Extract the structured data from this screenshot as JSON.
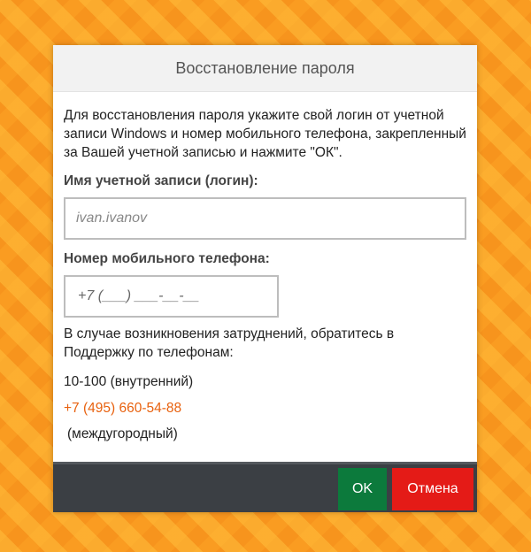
{
  "dialog": {
    "title": "Восстановление пароля",
    "description": "Для восстановления пароля укажите свой логин от учетной записи Windows и номер мобильного телефона, закрепленный за Вашей учетной записью и нажмите \"ОК\".",
    "login": {
      "label": "Имя учетной записи (логин):",
      "placeholder": "ivan.ivanov",
      "value": ""
    },
    "phone": {
      "label": "Номер мобильного телефона:",
      "placeholder": "+7 (___) ___-__-__",
      "value": ""
    },
    "help": {
      "text": "В случае возникновения затруднений, обратитесь в Поддержку по телефонам:",
      "internal_phone": "10-100 (внутренний)",
      "external_phone": "+7 (495) 660-54-88",
      "external_note": "(междугородный)"
    },
    "buttons": {
      "ok": "OK",
      "cancel": "Отмена"
    }
  },
  "colors": {
    "background": "#f7941d",
    "ok_button": "#0c7a3c",
    "cancel_button": "#e41b17",
    "footer": "#3b3f44",
    "link": "#e8610e"
  }
}
